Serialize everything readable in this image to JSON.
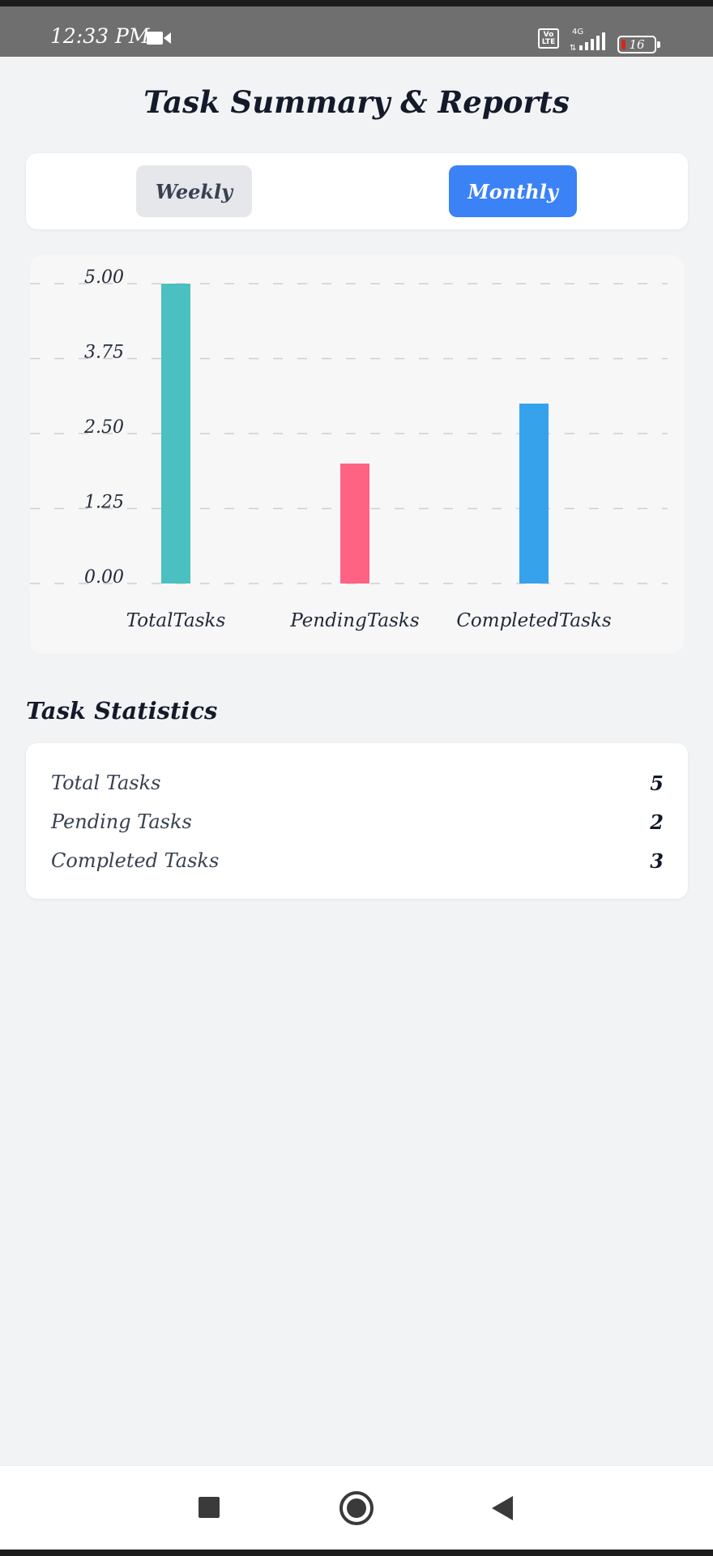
{
  "status_bar": {
    "time": "12:33 PM",
    "video_icon": "video-camera-icon",
    "volte": "Vo LTE",
    "network": "4G",
    "battery": "16"
  },
  "title": "Task Summary & Reports",
  "toggle": {
    "options": [
      "Weekly",
      "Monthly"
    ],
    "selected": "Monthly"
  },
  "chart_data": {
    "type": "bar",
    "categories": [
      "TotalTasks",
      "PendingTasks",
      "CompletedTasks"
    ],
    "values": [
      5,
      2,
      3
    ],
    "colors": [
      "#4bc0c0",
      "#ff6384",
      "#36a2eb"
    ],
    "yticks": [
      "0.00",
      "1.25",
      "2.50",
      "3.75",
      "5.00"
    ],
    "ylim": [
      0,
      5
    ],
    "grid": true,
    "title": "",
    "xlabel": "",
    "ylabel": ""
  },
  "statistics": {
    "title": "Task Statistics",
    "rows": [
      {
        "label": "Total Tasks",
        "value": "5"
      },
      {
        "label": "Pending Tasks",
        "value": "2"
      },
      {
        "label": "Completed Tasks",
        "value": "3"
      }
    ]
  },
  "nav": {
    "recent_icon": "square-icon",
    "home_icon": "circle-icon",
    "back_icon": "triangle-back-icon"
  }
}
